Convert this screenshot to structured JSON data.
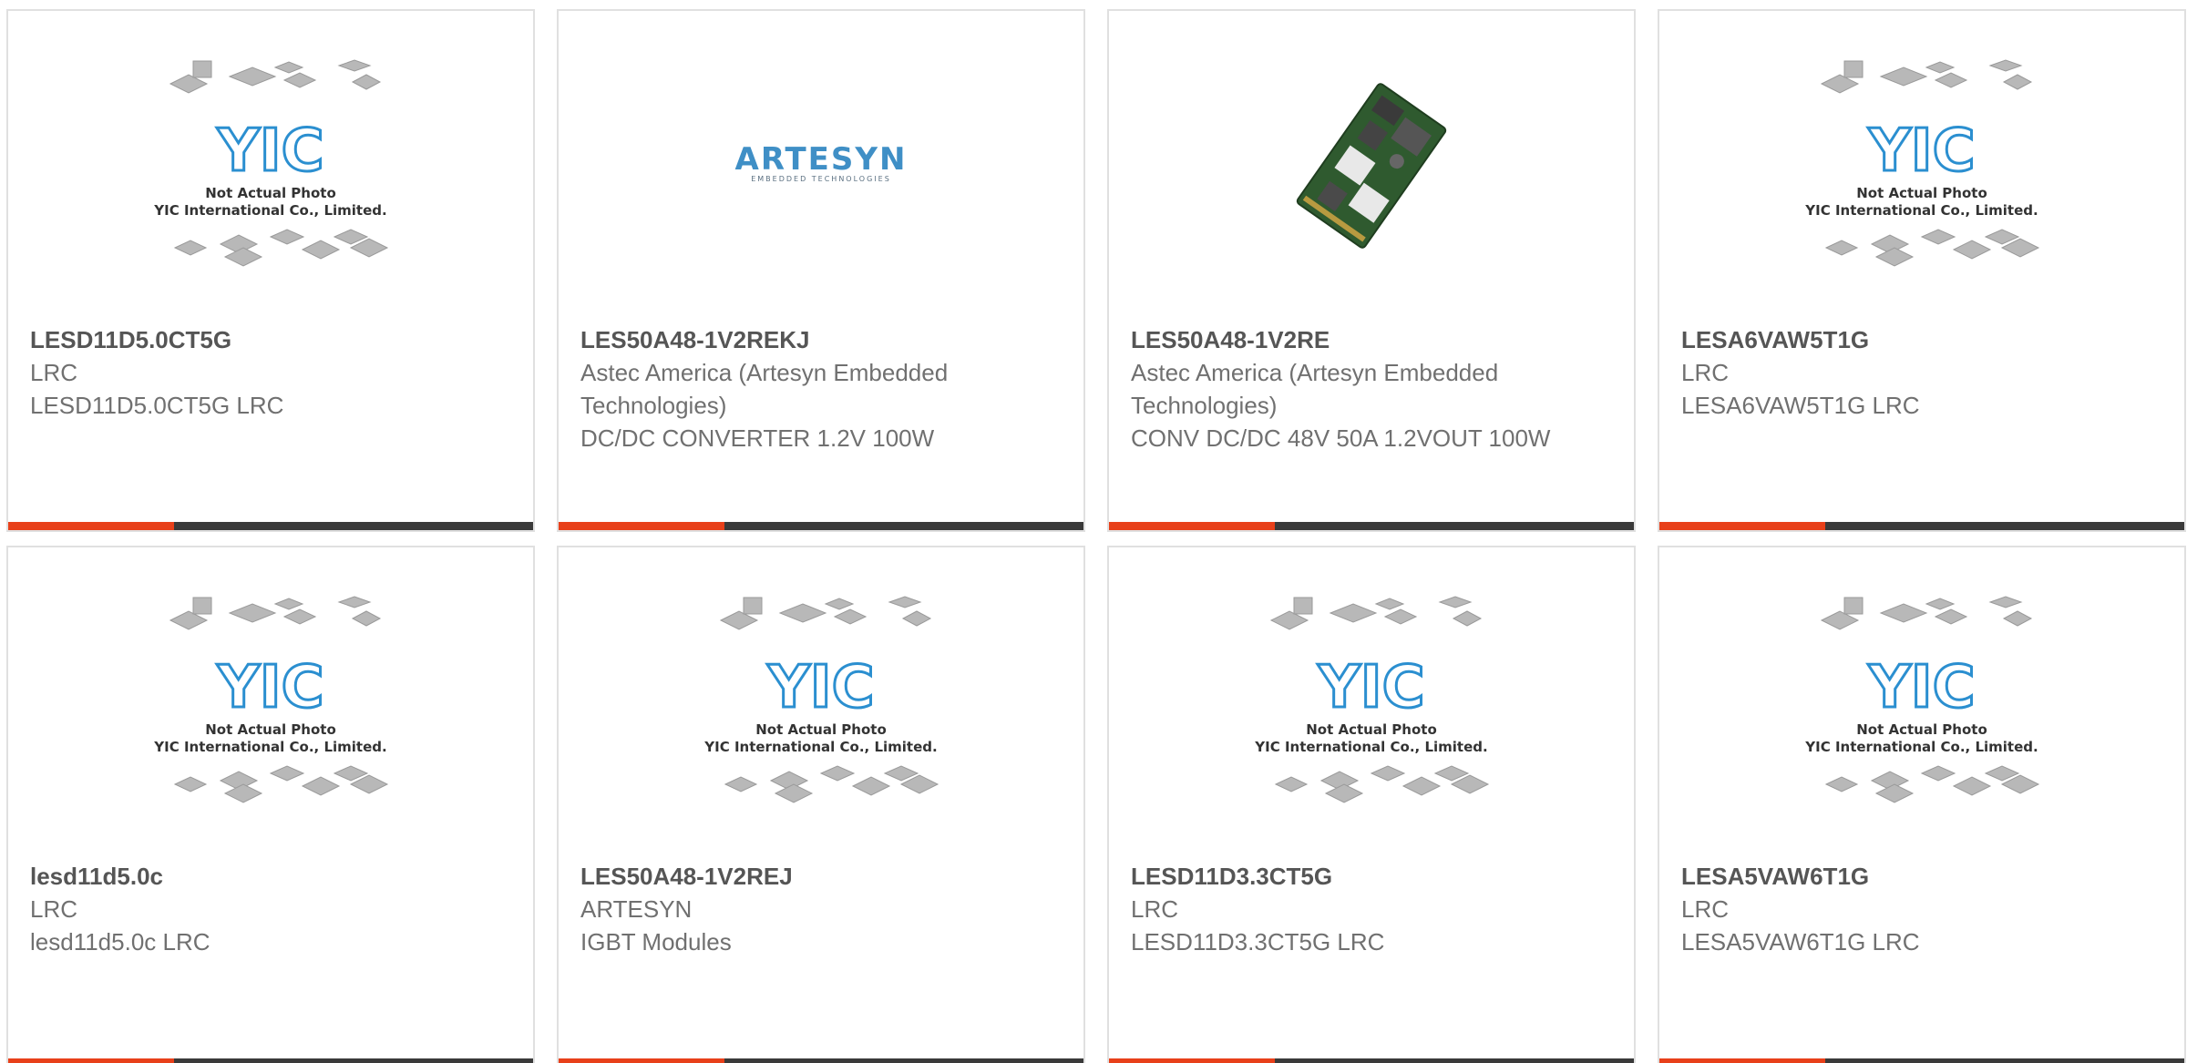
{
  "placeholder": {
    "logo_text": "YIC",
    "caption_line1": "Not Actual Photo",
    "caption_line2": "YIC International Co., Limited."
  },
  "artesyn_logo": {
    "name": "ARTESYN",
    "tagline": "EMBEDDED TECHNOLOGIES"
  },
  "colors": {
    "accent": "#e8401a",
    "bar": "#3a3a3a",
    "logo_blue": "#2b8fd0"
  },
  "products": [
    {
      "image": "placeholder",
      "part": "LESD11D5.0CT5G",
      "manufacturer": "LRC",
      "description": "LESD11D5.0CT5G LRC"
    },
    {
      "image": "artesyn-logo",
      "part": "LES50A48-1V2REKJ",
      "manufacturer": "Astec America (Artesyn Embedded Technologies)",
      "description": "DC/DC CONVERTER 1.2V 100W"
    },
    {
      "image": "product-photo",
      "part": "LES50A48-1V2RE",
      "manufacturer": "Astec America (Artesyn Embedded Technologies)",
      "description": "CONV DC/DC 48V 50A 1.2VOUT 100W"
    },
    {
      "image": "placeholder",
      "part": "LESA6VAW5T1G",
      "manufacturer": "LRC",
      "description": "LESA6VAW5T1G LRC"
    },
    {
      "image": "placeholder",
      "part": "lesd11d5.0c",
      "manufacturer": "LRC",
      "description": "lesd11d5.0c LRC"
    },
    {
      "image": "placeholder",
      "part": "LES50A48-1V2REJ",
      "manufacturer": "ARTESYN",
      "description": "IGBT Modules"
    },
    {
      "image": "placeholder",
      "part": "LESD11D3.3CT5G",
      "manufacturer": "LRC",
      "description": "LESD11D3.3CT5G LRC"
    },
    {
      "image": "placeholder",
      "part": "LESA5VAW6T1G",
      "manufacturer": "LRC",
      "description": "LESA5VAW6T1G LRC"
    }
  ]
}
